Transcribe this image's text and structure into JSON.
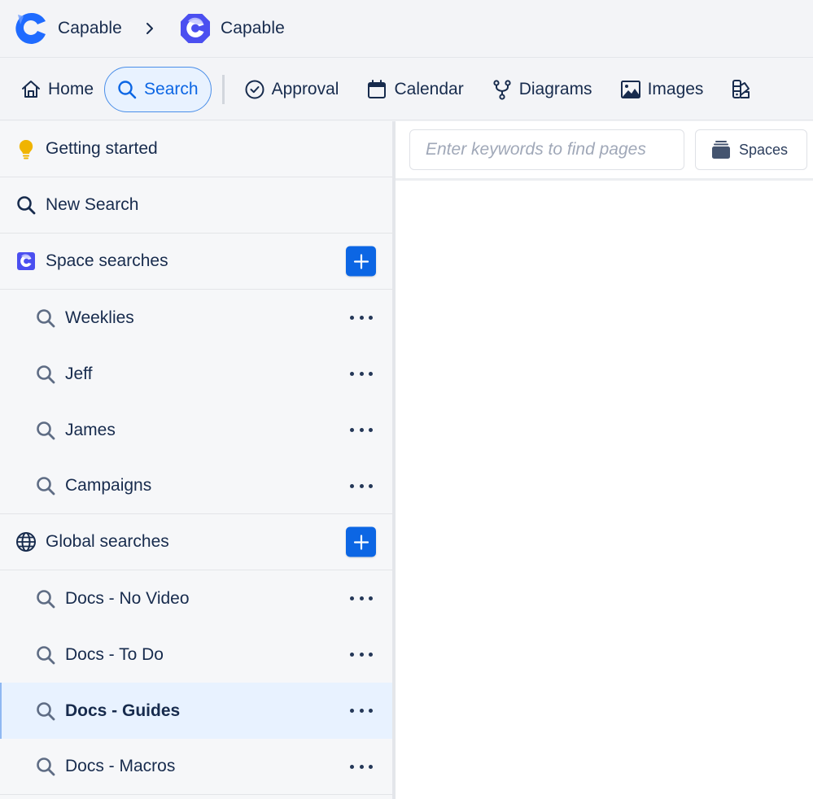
{
  "breadcrumb": {
    "app_name": "Capable",
    "space_name": "Capable"
  },
  "nav": {
    "items": [
      {
        "label": "Home",
        "icon": "home-icon",
        "active": false
      },
      {
        "label": "Search",
        "icon": "search-icon",
        "active": true
      },
      {
        "label": "Approval",
        "icon": "check-circle-icon",
        "active": false
      },
      {
        "label": "Calendar",
        "icon": "calendar-icon",
        "active": false
      },
      {
        "label": "Diagrams",
        "icon": "branch-icon",
        "active": false
      },
      {
        "label": "Images",
        "icon": "image-icon",
        "active": false
      },
      {
        "label": "",
        "icon": "swatch-icon",
        "active": false
      }
    ]
  },
  "sidebar": {
    "getting_started": {
      "label": "Getting started",
      "icon": "lightbulb-icon"
    },
    "new_search": {
      "label": "New Search",
      "icon": "search-icon"
    },
    "space_searches": {
      "label": "Space searches",
      "icon": "capable-space-icon",
      "items": [
        {
          "label": "Weeklies"
        },
        {
          "label": "Jeff"
        },
        {
          "label": "James"
        },
        {
          "label": "Campaigns"
        }
      ]
    },
    "global_searches": {
      "label": "Global searches",
      "icon": "globe-icon",
      "items": [
        {
          "label": "Docs - No Video",
          "selected": false
        },
        {
          "label": "Docs - To Do",
          "selected": false
        },
        {
          "label": "Docs - Guides",
          "selected": true
        },
        {
          "label": "Docs - Macros",
          "selected": false
        }
      ]
    }
  },
  "main": {
    "search_placeholder": "Enter keywords to find pages",
    "search_value": "",
    "spaces_label": "Spaces"
  },
  "colors": {
    "accent": "#0c66e4",
    "selected_bg": "#e8f2ff",
    "text": "#172b4d",
    "bulb": "#f0b400",
    "logo_blue": "#1f6bff",
    "space_logo": "#4b4ff0"
  }
}
